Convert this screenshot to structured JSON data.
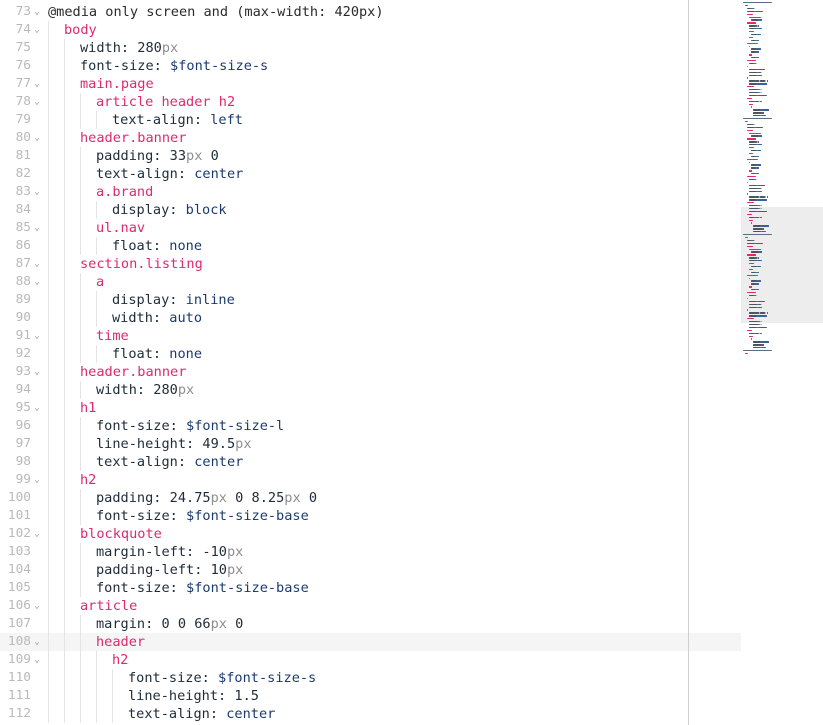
{
  "editor": {
    "current_line": 108,
    "lines": [
      {
        "n": "73",
        "fold": true,
        "indent": 0,
        "tokens": [
          [
            "plain",
            "@media only screen and (max-width: 420px)"
          ]
        ]
      },
      {
        "n": "74",
        "fold": true,
        "indent": 1,
        "tokens": [
          [
            "sel",
            "body"
          ]
        ]
      },
      {
        "n": "75",
        "fold": false,
        "indent": 2,
        "tokens": [
          [
            "prop",
            "width: "
          ],
          [
            "num",
            "280"
          ],
          [
            "unit",
            "px"
          ]
        ]
      },
      {
        "n": "76",
        "fold": false,
        "indent": 2,
        "tokens": [
          [
            "prop",
            "font-size: "
          ],
          [
            "var",
            "$font-size-s"
          ]
        ]
      },
      {
        "n": "77",
        "fold": true,
        "indent": 2,
        "tokens": [
          [
            "sel",
            "main.page"
          ]
        ]
      },
      {
        "n": "78",
        "fold": true,
        "indent": 3,
        "tokens": [
          [
            "sel",
            "article header h2"
          ]
        ]
      },
      {
        "n": "79",
        "fold": false,
        "indent": 4,
        "tokens": [
          [
            "prop",
            "text-align: "
          ],
          [
            "val",
            "left"
          ]
        ]
      },
      {
        "n": "80",
        "fold": true,
        "indent": 2,
        "tokens": [
          [
            "sel",
            "header.banner"
          ]
        ]
      },
      {
        "n": "81",
        "fold": false,
        "indent": 3,
        "tokens": [
          [
            "prop",
            "padding: "
          ],
          [
            "num",
            "33"
          ],
          [
            "unit",
            "px"
          ],
          [
            "num",
            " 0"
          ]
        ]
      },
      {
        "n": "82",
        "fold": false,
        "indent": 3,
        "tokens": [
          [
            "prop",
            "text-align: "
          ],
          [
            "val",
            "center"
          ]
        ]
      },
      {
        "n": "83",
        "fold": true,
        "indent": 3,
        "tokens": [
          [
            "sel",
            "a.brand"
          ]
        ]
      },
      {
        "n": "84",
        "fold": false,
        "indent": 4,
        "tokens": [
          [
            "prop",
            "display: "
          ],
          [
            "val",
            "block"
          ]
        ]
      },
      {
        "n": "85",
        "fold": true,
        "indent": 3,
        "tokens": [
          [
            "sel",
            "ul.nav"
          ]
        ]
      },
      {
        "n": "86",
        "fold": false,
        "indent": 4,
        "tokens": [
          [
            "prop",
            "float: "
          ],
          [
            "val",
            "none"
          ]
        ]
      },
      {
        "n": "87",
        "fold": true,
        "indent": 2,
        "tokens": [
          [
            "sel",
            "section.listing"
          ]
        ]
      },
      {
        "n": "88",
        "fold": true,
        "indent": 3,
        "tokens": [
          [
            "sel",
            "a"
          ]
        ]
      },
      {
        "n": "89",
        "fold": false,
        "indent": 4,
        "tokens": [
          [
            "prop",
            "display: "
          ],
          [
            "val",
            "inline"
          ]
        ]
      },
      {
        "n": "90",
        "fold": false,
        "indent": 4,
        "tokens": [
          [
            "prop",
            "width: "
          ],
          [
            "val",
            "auto"
          ]
        ]
      },
      {
        "n": "91",
        "fold": true,
        "indent": 3,
        "tokens": [
          [
            "sel",
            "time"
          ]
        ]
      },
      {
        "n": "92",
        "fold": false,
        "indent": 4,
        "tokens": [
          [
            "prop",
            "float: "
          ],
          [
            "val",
            "none"
          ]
        ]
      },
      {
        "n": "93",
        "fold": true,
        "indent": 2,
        "tokens": [
          [
            "sel",
            "header.banner"
          ]
        ]
      },
      {
        "n": "94",
        "fold": false,
        "indent": 3,
        "tokens": [
          [
            "prop",
            "width: "
          ],
          [
            "num",
            "280"
          ],
          [
            "unit",
            "px"
          ]
        ]
      },
      {
        "n": "95",
        "fold": true,
        "indent": 2,
        "tokens": [
          [
            "sel",
            "h1"
          ]
        ]
      },
      {
        "n": "96",
        "fold": false,
        "indent": 3,
        "tokens": [
          [
            "prop",
            "font-size: "
          ],
          [
            "var",
            "$font-size-l"
          ]
        ]
      },
      {
        "n": "97",
        "fold": false,
        "indent": 3,
        "tokens": [
          [
            "prop",
            "line-height: "
          ],
          [
            "num",
            "49.5"
          ],
          [
            "unit",
            "px"
          ]
        ]
      },
      {
        "n": "98",
        "fold": false,
        "indent": 3,
        "tokens": [
          [
            "prop",
            "text-align: "
          ],
          [
            "val",
            "center"
          ]
        ]
      },
      {
        "n": "99",
        "fold": true,
        "indent": 2,
        "tokens": [
          [
            "sel",
            "h2"
          ]
        ]
      },
      {
        "n": "100",
        "fold": false,
        "indent": 3,
        "tokens": [
          [
            "prop",
            "padding: "
          ],
          [
            "num",
            "24.75"
          ],
          [
            "unit",
            "px"
          ],
          [
            "num",
            " 0 8.25"
          ],
          [
            "unit",
            "px"
          ],
          [
            "num",
            " 0"
          ]
        ]
      },
      {
        "n": "101",
        "fold": false,
        "indent": 3,
        "tokens": [
          [
            "prop",
            "font-size: "
          ],
          [
            "var",
            "$font-size-base"
          ]
        ]
      },
      {
        "n": "102",
        "fold": true,
        "indent": 2,
        "tokens": [
          [
            "sel",
            "blockquote"
          ]
        ]
      },
      {
        "n": "103",
        "fold": false,
        "indent": 3,
        "tokens": [
          [
            "prop",
            "margin-left: "
          ],
          [
            "num",
            "-10"
          ],
          [
            "unit",
            "px"
          ]
        ]
      },
      {
        "n": "104",
        "fold": false,
        "indent": 3,
        "tokens": [
          [
            "prop",
            "padding-left: "
          ],
          [
            "num",
            "10"
          ],
          [
            "unit",
            "px"
          ]
        ]
      },
      {
        "n": "105",
        "fold": false,
        "indent": 3,
        "tokens": [
          [
            "prop",
            "font-size: "
          ],
          [
            "var",
            "$font-size-base"
          ]
        ]
      },
      {
        "n": "106",
        "fold": true,
        "indent": 2,
        "tokens": [
          [
            "sel",
            "article"
          ]
        ]
      },
      {
        "n": "107",
        "fold": false,
        "indent": 3,
        "tokens": [
          [
            "prop",
            "margin: "
          ],
          [
            "num",
            "0 0 66"
          ],
          [
            "unit",
            "px"
          ],
          [
            "num",
            " 0"
          ]
        ]
      },
      {
        "n": "108",
        "fold": true,
        "indent": 3,
        "tokens": [
          [
            "sel",
            "header"
          ]
        ]
      },
      {
        "n": "109",
        "fold": true,
        "indent": 4,
        "tokens": [
          [
            "sel",
            "h2"
          ]
        ]
      },
      {
        "n": "110",
        "fold": false,
        "indent": 5,
        "tokens": [
          [
            "prop",
            "font-size: "
          ],
          [
            "var",
            "$font-size-s"
          ]
        ]
      },
      {
        "n": "111",
        "fold": false,
        "indent": 5,
        "tokens": [
          [
            "prop",
            "line-height: "
          ],
          [
            "num",
            "1.5"
          ]
        ]
      },
      {
        "n": "112",
        "fold": false,
        "indent": 5,
        "tokens": [
          [
            "prop",
            "text-align: "
          ],
          [
            "val",
            "center"
          ]
        ]
      }
    ]
  },
  "colors": {
    "selector": "#e2286e",
    "value": "#1b3b6f",
    "unit": "#8e8e8e",
    "gutter": "#b9b9b9"
  },
  "icons": {
    "fold_marker": "chevron-down-icon"
  }
}
